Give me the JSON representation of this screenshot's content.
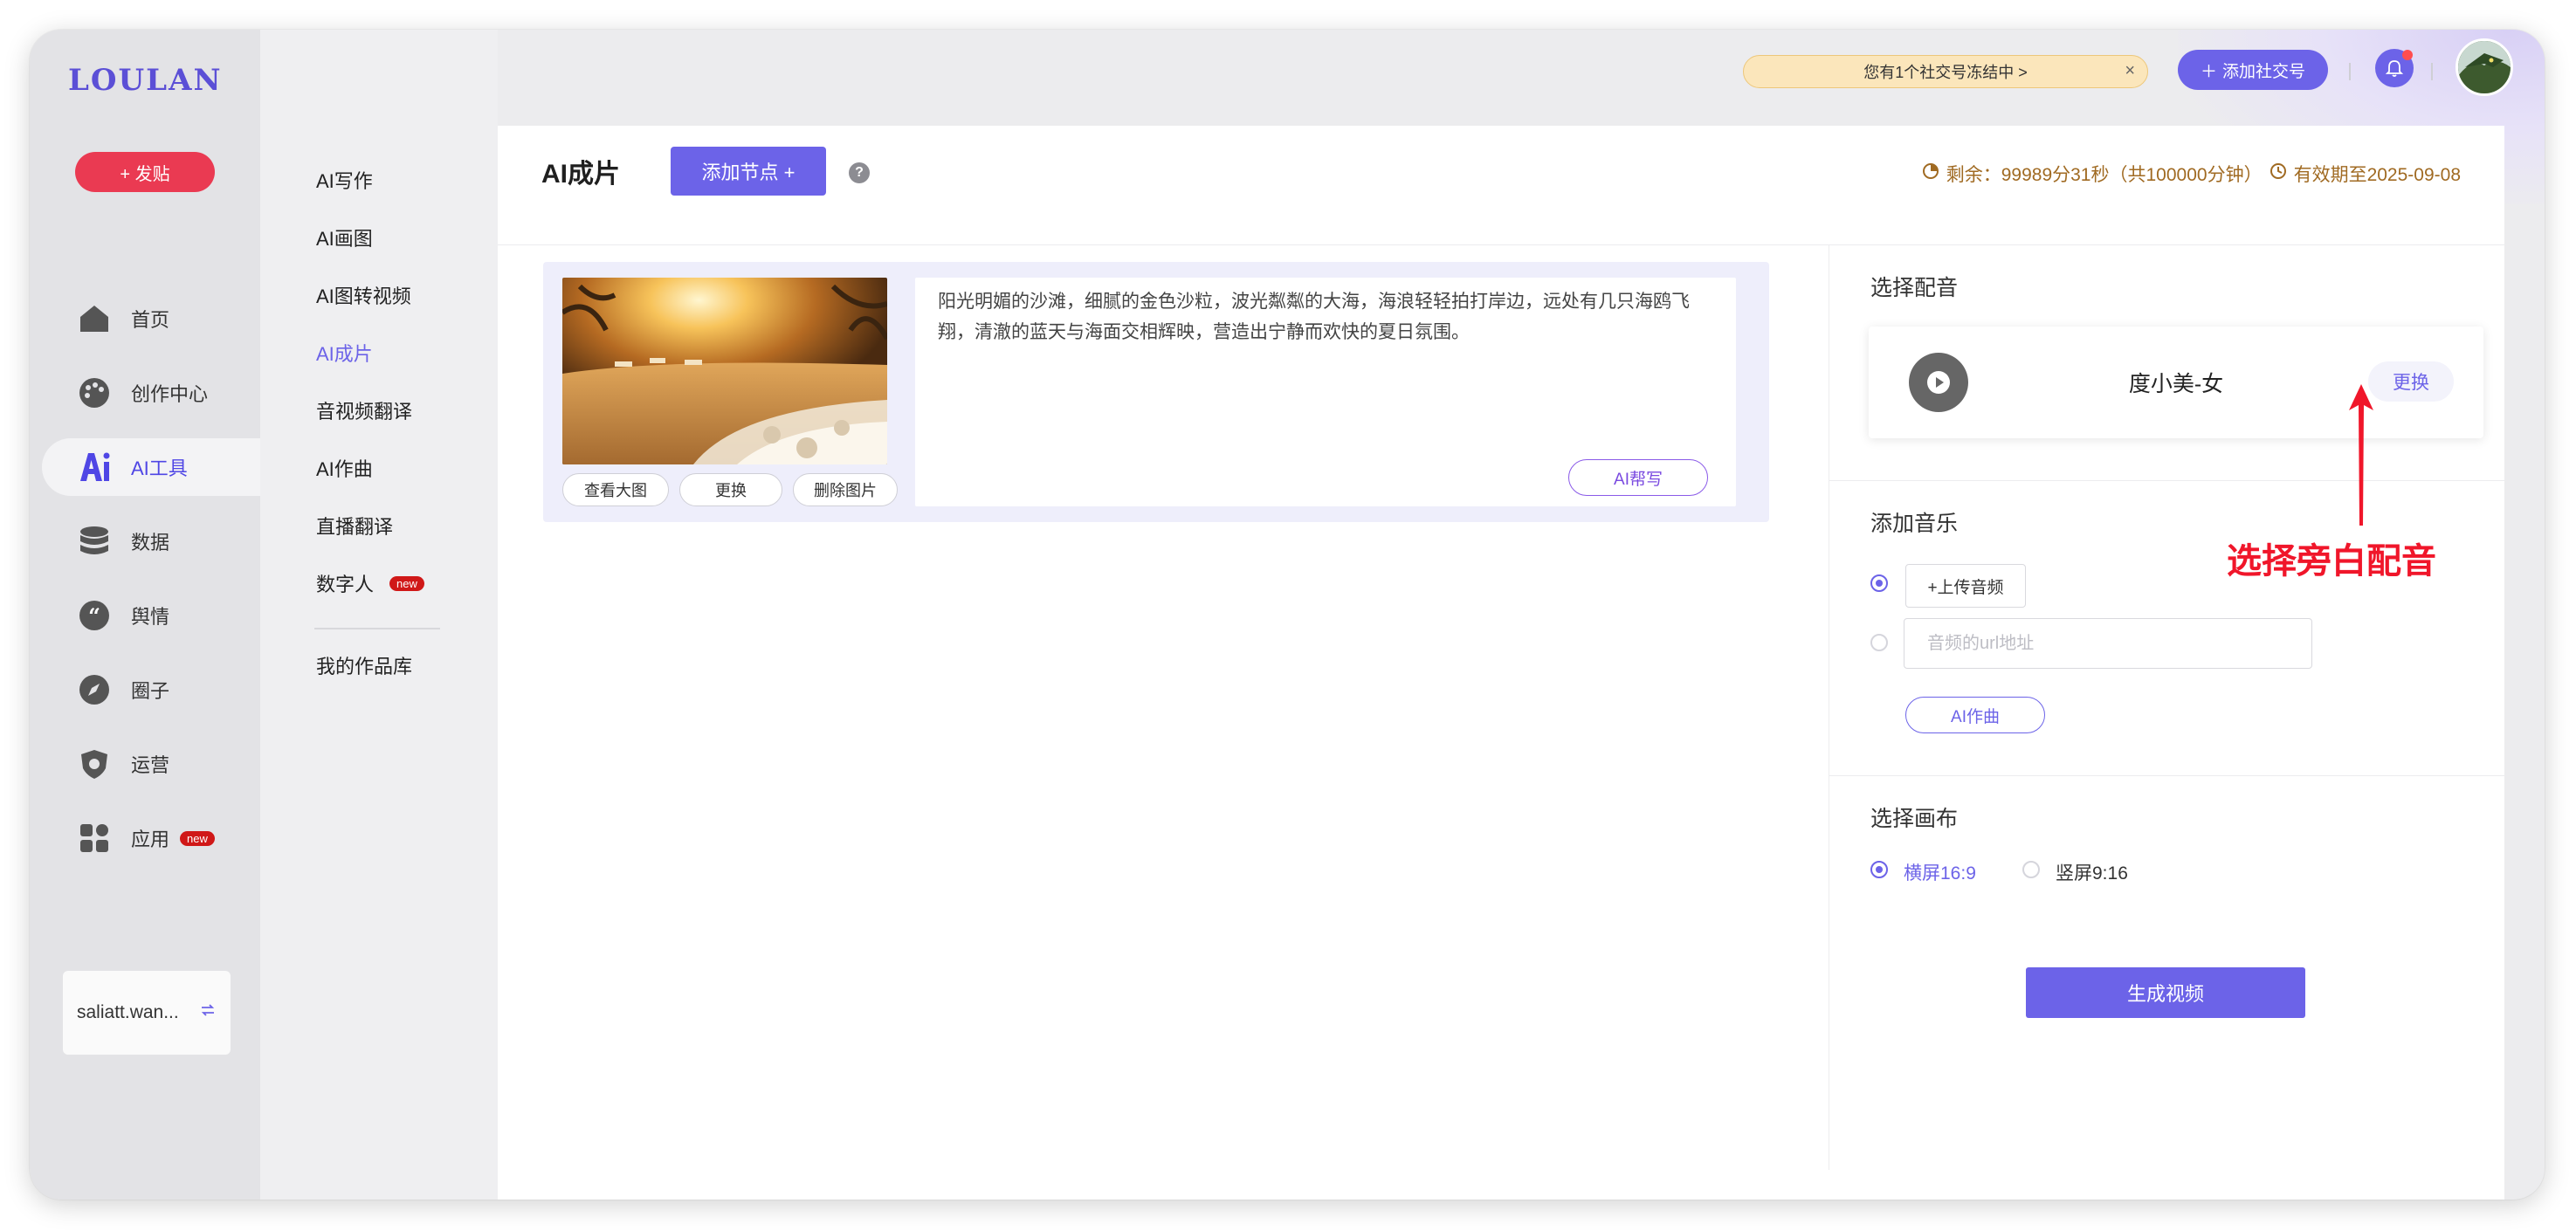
{
  "app": {
    "logo": "LOULAN",
    "post_label": "+ 发贴",
    "user_name": "saliatt.wan..."
  },
  "leftnav": [
    {
      "label": "首页",
      "icon": "home-icon"
    },
    {
      "label": "创作中心",
      "icon": "palette-icon"
    },
    {
      "label": "AI工具",
      "icon": "ai-icon",
      "active": true
    },
    {
      "label": "数据",
      "icon": "database-icon"
    },
    {
      "label": "舆情",
      "icon": "quote-icon"
    },
    {
      "label": "圈子",
      "icon": "compass-icon"
    },
    {
      "label": "运营",
      "icon": "shield-icon"
    },
    {
      "label": "应用",
      "icon": "apps-icon",
      "badge": "new"
    }
  ],
  "subnav": [
    {
      "label": "AI写作"
    },
    {
      "label": "AI画图"
    },
    {
      "label": "AI图转视频"
    },
    {
      "label": "AI成片",
      "active": true
    },
    {
      "label": "音视频翻译"
    },
    {
      "label": "AI作曲"
    },
    {
      "label": "直播翻译"
    },
    {
      "label": "数字人",
      "badge": "new"
    },
    {
      "label": "我的作品库"
    }
  ],
  "topbar": {
    "notice": "您有1个社交号冻结中 >",
    "notice_close": "×",
    "add_social": "添加社交号"
  },
  "main": {
    "title": "AI成片",
    "add_node": "添加节点 +",
    "help": "?",
    "quota": "剩余：99989分31秒（共100000分钟）",
    "expiry": "有效期至2025-09-08"
  },
  "node": {
    "description": "阳光明媚的沙滩，细腻的金色沙粒，波光粼粼的大海，海浪轻轻拍打岸边，远处有几只海鸥飞翔，清澈的蓝天与海面交相辉映，营造出宁静而欢快的夏日氛围。",
    "view_large": "查看大图",
    "replace": "更换",
    "delete_image": "删除图片",
    "ai_write": "AI帮写"
  },
  "settings": {
    "voice_title": "选择配音",
    "voice_name": "度小美-女",
    "voice_change": "更换",
    "music_title": "添加音乐",
    "upload_audio": "+上传音频",
    "url_placeholder": "音频的url地址",
    "ai_song": "AI作曲",
    "canvas_title": "选择画布",
    "canvas_landscape": "横屏16:9",
    "canvas_portrait": "竖屏9:16",
    "generate": "生成视频"
  },
  "annotation": {
    "text": "选择旁白配音"
  },
  "colors": {
    "accent": "#6c63e8",
    "post_button": "#ea3a52",
    "annotation": "#f0162a",
    "quota_text": "#a06a22"
  }
}
